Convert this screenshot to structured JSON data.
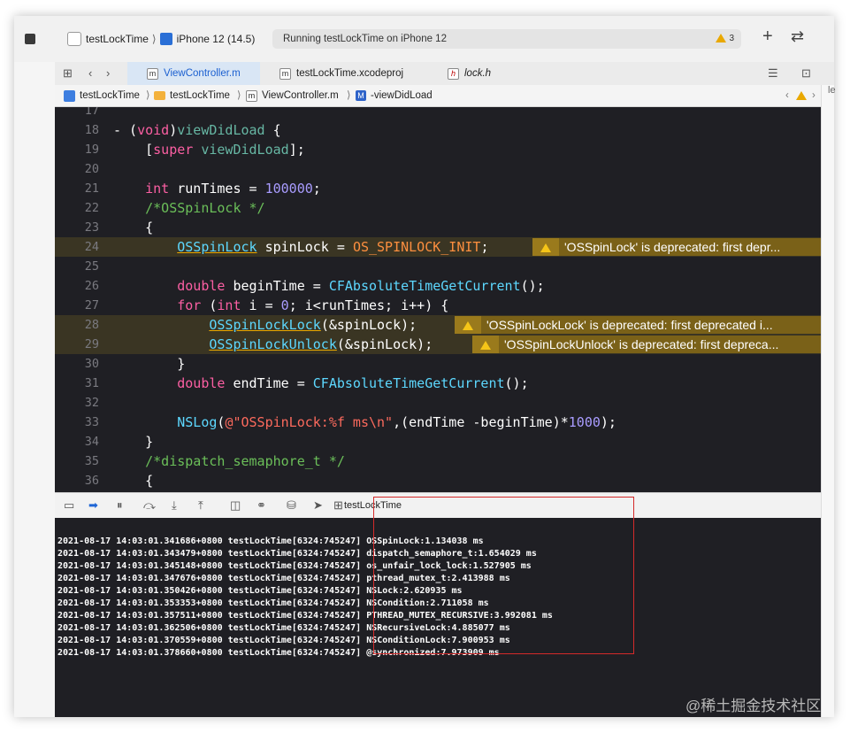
{
  "toolbar": {
    "scheme_target": "testLockTime",
    "device": "iPhone 12 (14.5)",
    "activity": "Running testLockTime on iPhone 12",
    "warning_count": "3"
  },
  "tabs": [
    {
      "badge": "m",
      "label": "ViewController.m"
    },
    {
      "badge": "m",
      "label": "testLockTime.xcodeproj"
    },
    {
      "badge": "h",
      "label": "lock.h"
    }
  ],
  "jumpbar": {
    "project": "testLockTime",
    "group": "testLockTime",
    "file": "ViewController.m",
    "symbol_badge": "M",
    "symbol": "-viewDidLoad"
  },
  "editor": {
    "lines": [
      "17",
      "18",
      "19",
      "20",
      "21",
      "22",
      "23",
      "24",
      "25",
      "26",
      "27",
      "28",
      "29",
      "30",
      "31",
      "32",
      "33",
      "34",
      "35",
      "36"
    ],
    "code": {
      "l18a": "- (",
      "l18b": "void",
      "l18c": ")",
      "l18d": "viewDidLoad",
      "l18e": " {",
      "l19a": "    [",
      "l19b": "super",
      "l19c": " ",
      "l19d": "viewDidLoad",
      "l19e": "];",
      "l21a": "    ",
      "l21b": "int",
      "l21c": " runTimes = ",
      "l21d": "100000",
      "l21e": ";",
      "l22": "    /*OSSpinLock */",
      "l23": "    {",
      "l24a": "        ",
      "l24b": "OSSpinLock",
      "l24c": " spinLock = ",
      "l24d": "OS_SPINLOCK_INIT",
      "l24e": ";",
      "l26a": "        ",
      "l26b": "double",
      "l26c": " beginTime = ",
      "l26d": "CFAbsoluteTimeGetCurrent",
      "l26e": "();",
      "l27a": "        ",
      "l27b": "for",
      "l27c": " (",
      "l27d": "int",
      "l27e": " i = ",
      "l27f": "0",
      "l27g": "; i<runTimes; i++) {",
      "l28a": "            ",
      "l28b": "OSSpinLockLock",
      "l28c": "(&spinLock);",
      "l29a": "            ",
      "l29b": "OSSpinLockUnlock",
      "l29c": "(&spinLock);",
      "l30": "        }",
      "l31a": "        ",
      "l31b": "double",
      "l31c": " endTime = ",
      "l31d": "CFAbsoluteTimeGetCurrent",
      "l31e": "();",
      "l33a": "        ",
      "l33b": "NSLog",
      "l33c": "(",
      "l33d": "@\"OSSpinLock:%f ms\\n\"",
      "l33e": ",(endTime -beginTime)*",
      "l33f": "1000",
      "l33g": ");",
      "l34": "    }",
      "l35": "    /*dispatch_semaphore_t */",
      "l36": "    {"
    },
    "warnings": {
      "w24": "'OSSpinLock' is deprecated: first depr...",
      "w28": "'OSSpinLockLock' is deprecated: first deprecated i...",
      "w29": "'OSSpinLockUnlock' is deprecated: first depreca..."
    }
  },
  "debug": {
    "target": "testLockTime"
  },
  "console": {
    "lines": [
      "2021-08-17 14:03:01.341686+0800 testLockTime[6324:745247] OSSpinLock:1.134038 ms",
      "2021-08-17 14:03:01.343479+0800 testLockTime[6324:745247] dispatch_semaphore_t:1.654029 ms",
      "2021-08-17 14:03:01.345148+0800 testLockTime[6324:745247] os_unfair_lock_lock:1.527905 ms",
      "2021-08-17 14:03:01.347676+0800 testLockTime[6324:745247] pthread_mutex_t:2.413988 ms",
      "2021-08-17 14:03:01.350426+0800 testLockTime[6324:745247] NSLock:2.620935 ms",
      "2021-08-17 14:03:01.353353+0800 testLockTime[6324:745247] NSCondition:2.711058 ms",
      "2021-08-17 14:03:01.357511+0800 testLockTime[6324:745247] PTHREAD_MUTEX_RECURSIVE:3.992081 ms",
      "2021-08-17 14:03:01.362506+0800 testLockTime[6324:745247] NSRecursiveLock:4.885077 ms",
      "2021-08-17 14:03:01.370559+0800 testLockTime[6324:745247] NSConditionLock:7.900953 ms",
      "2021-08-17 14:03:01.378660+0800 testLockTime[6324:745247] @synchronized:7.973909 ms"
    ]
  },
  "watermark": "@稀土掘金技术社区",
  "colors": {
    "accent": "#1f66d6",
    "warning": "#e9a800",
    "highlight_box": "#d42a2a",
    "editor_bg": "#1f1f24"
  }
}
